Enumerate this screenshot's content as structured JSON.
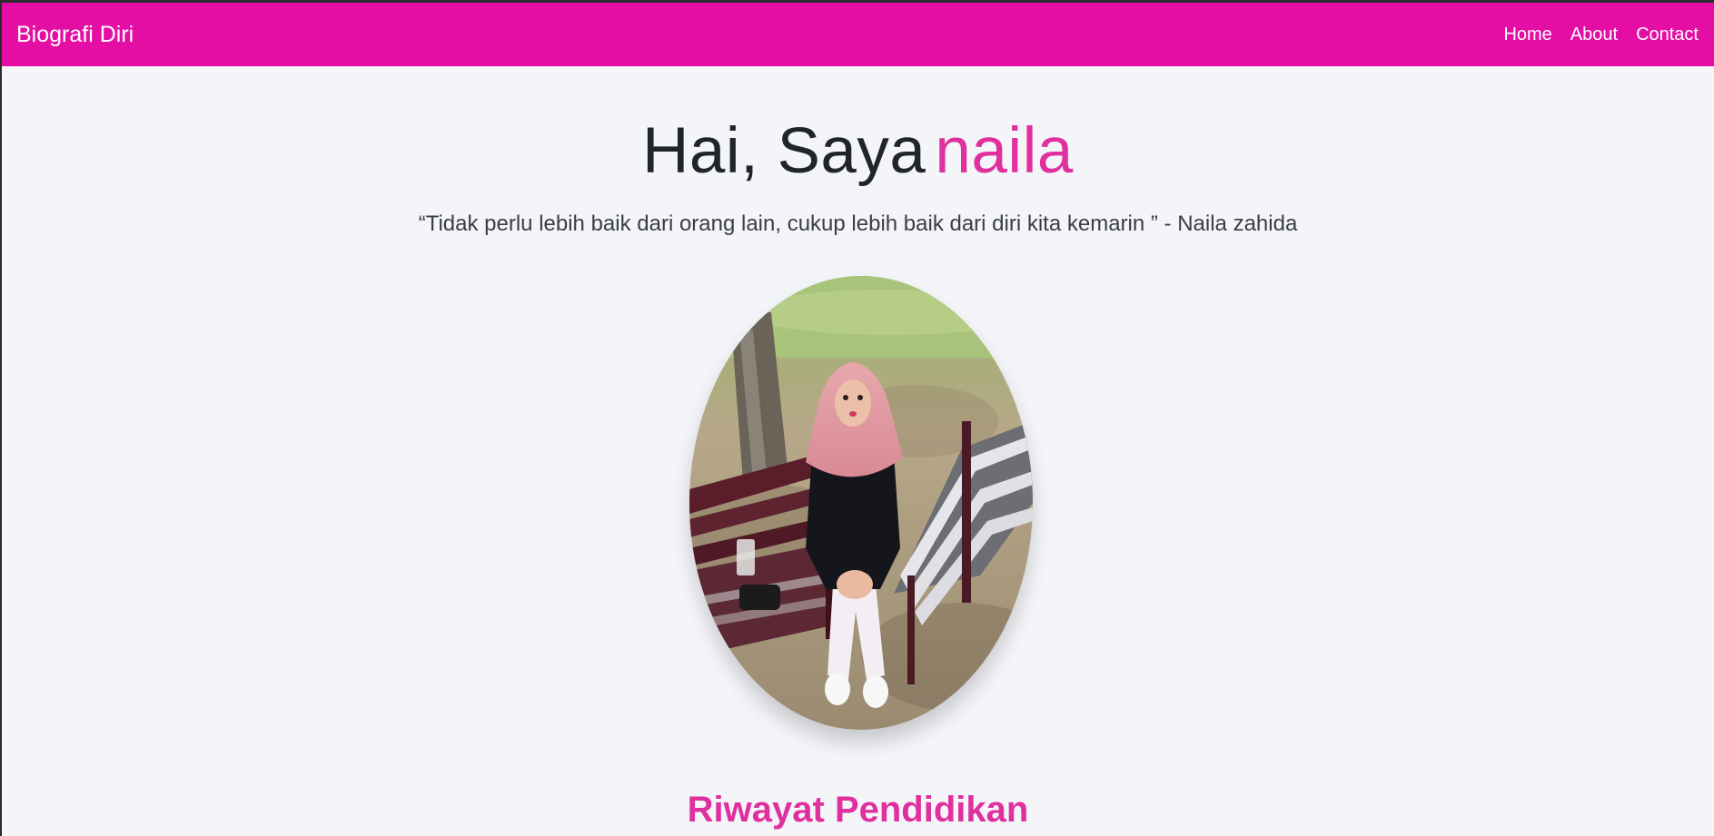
{
  "colors": {
    "brand": "#e40ea4",
    "accent": "#e0309f",
    "page_background": "#f4f5f9",
    "text": "#212529"
  },
  "navbar": {
    "brand": "Biografi Diri",
    "links": [
      "Home",
      "About",
      "Contact"
    ]
  },
  "hero": {
    "greeting": "Hai, Saya",
    "name": "naila",
    "quote": "“Tidak perlu lebih baik dari orang lain, cukup lebih baik dari diri kita kemarin ” - Naila zahida"
  },
  "profile_photo": {
    "icon": "profile-photo"
  },
  "section": {
    "heading": "Riwayat Pendidikan"
  }
}
